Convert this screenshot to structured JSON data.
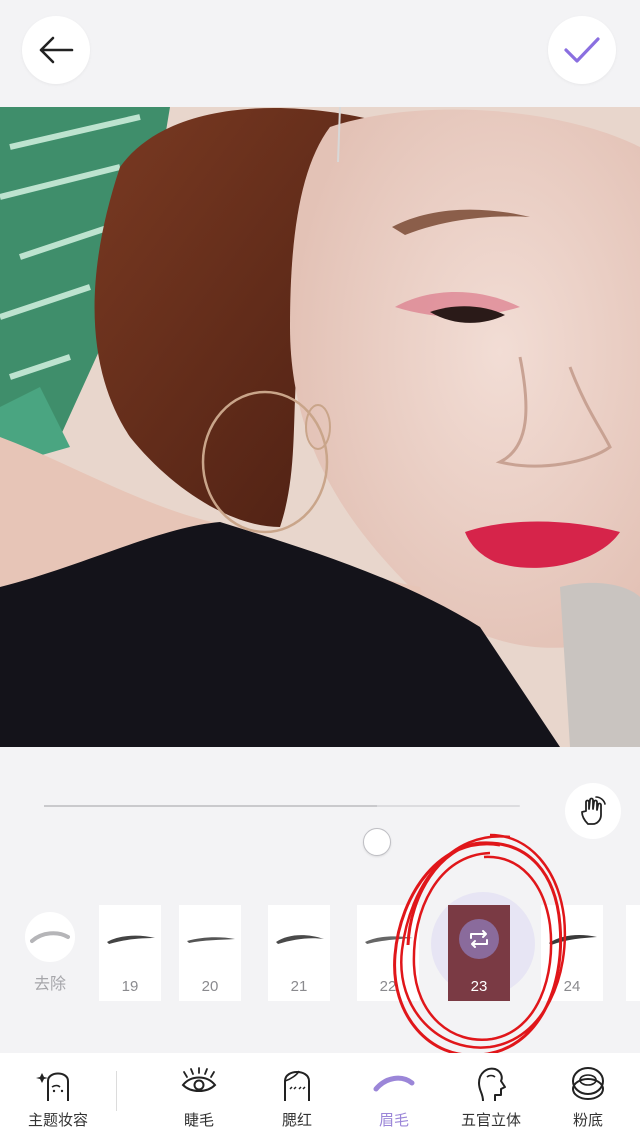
{
  "colors": {
    "accent": "#8a6fe0",
    "annotation": "#e0161a",
    "selected_card": "#7a3a44",
    "active_tab": "#9b86d8"
  },
  "topbar": {
    "back_icon": "arrow-left-icon",
    "confirm_icon": "checkmark-icon"
  },
  "slider": {
    "value": 0.7,
    "compare_icon": "hand-tap-icon"
  },
  "styles": {
    "remove_label": "去除",
    "items": [
      {
        "number": "19"
      },
      {
        "number": "20"
      },
      {
        "number": "21"
      },
      {
        "number": "22"
      },
      {
        "number": "23",
        "selected": true,
        "icon": "flip-arrows-icon"
      },
      {
        "number": "24"
      }
    ]
  },
  "nav": {
    "items": [
      {
        "label": "主题妆容",
        "icon": "face-sparkle-icon"
      },
      {
        "label": "睫毛",
        "icon": "eyelash-icon"
      },
      {
        "label": "腮红",
        "icon": "blush-face-icon"
      },
      {
        "label": "眉毛",
        "icon": "eyebrow-icon",
        "active": true
      },
      {
        "label": "五官立体",
        "icon": "face-profile-icon"
      },
      {
        "label": "粉底",
        "icon": "compact-powder-icon"
      }
    ]
  }
}
